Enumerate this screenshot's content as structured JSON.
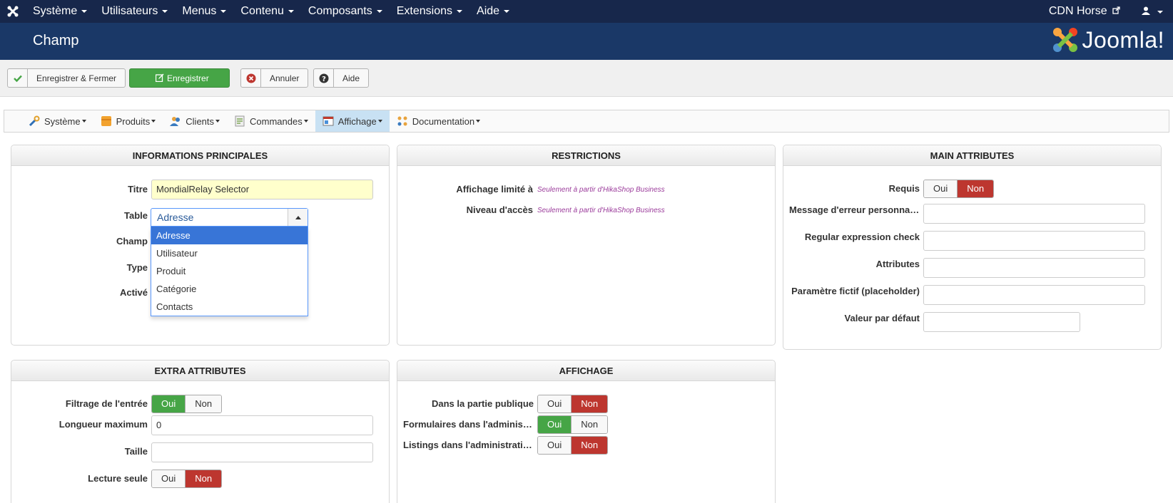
{
  "topnav": {
    "menu": [
      "Système",
      "Utilisateurs",
      "Menus",
      "Contenu",
      "Composants",
      "Extensions",
      "Aide"
    ],
    "site": "CDN Horse"
  },
  "header": {
    "title": "Champ",
    "brand": "Joomla!"
  },
  "toolbar": {
    "save_close": "Enregistrer & Fermer",
    "save": "Enregistrer",
    "cancel": "Annuler",
    "help": "Aide"
  },
  "hikamenu": {
    "items": [
      "Système",
      "Produits",
      "Clients",
      "Commandes",
      "Affichage",
      "Documentation"
    ],
    "active": "Affichage"
  },
  "main_info": {
    "header": "INFORMATIONS PRINCIPALES",
    "title_label": "Titre",
    "title_value": "MondialRelay Selector",
    "table_label": "Table",
    "table_value": "Adresse",
    "field_label": "Champ",
    "type_label": "Type",
    "enabled_label": "Activé",
    "table_options": [
      "Adresse",
      "Utilisateur",
      "Produit",
      "Catégorie",
      "Contacts"
    ]
  },
  "restrictions": {
    "header": "RESTRICTIONS",
    "display_label": "Affichage limité à",
    "display_note": "Seulement à partir d'HikaShop Business",
    "access_label": "Niveau d'accès",
    "access_note": "Seulement à partir d'HikaShop Business"
  },
  "main_attributes": {
    "header": "MAIN ATTRIBUTES",
    "required_label": "Requis",
    "error_label": "Message d'erreur personnalisé",
    "regex_label": "Regular expression check",
    "attributes_label": "Attributes",
    "placeholder_label": "Paramètre fictif (placeholder)",
    "default_label": "Valeur par défaut",
    "required_value": "Non"
  },
  "extra_attributes": {
    "header": "EXTRA ATTRIBUTES",
    "filter_label": "Filtrage de l'entrée",
    "filter_value": "Oui",
    "maxlen_label": "Longueur maximum",
    "maxlen_value": "0",
    "size_label": "Taille",
    "readonly_label": "Lecture seule",
    "readonly_value": "Non"
  },
  "affichage": {
    "header": "AFFICHAGE",
    "public_label": "Dans la partie publique",
    "public_value": "Non",
    "admin_forms_label": "Formulaires dans l'administration",
    "admin_forms_value": "Oui",
    "admin_listings_label": "Listings dans l'administration",
    "admin_listings_value": "Non"
  },
  "toggle": {
    "yes": "Oui",
    "no": "Non"
  },
  "colors": {
    "topnav": "#17274b",
    "header": "#1a3867",
    "green": "#46a546",
    "red": "#bd362f",
    "active_menu": "#c8e1f3",
    "note": "#9b3c9b"
  }
}
